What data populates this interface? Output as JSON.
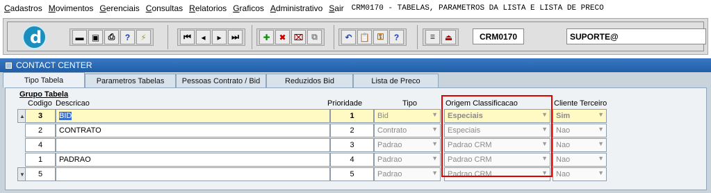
{
  "menu": {
    "items": [
      "Cadastros",
      "Movimentos",
      "Gerenciais",
      "Consultas",
      "Relatorios",
      "Graficos",
      "Administrativo",
      "Sair"
    ],
    "form_title": "CRM0170 - TABELAS, PARAMETROS DA LISTA E LISTA DE PRECO"
  },
  "toolbar": {
    "logo_letter": "d",
    "form_code": "CRM0170",
    "user": "SUPORTE@",
    "icons": [
      "save-icon",
      "frame-icon",
      "print-icon",
      "help-query-icon",
      "edit-wand-icon",
      "first-record-icon",
      "prev-record-icon",
      "next-record-icon",
      "last-record-icon",
      "add-record-icon",
      "delete-record-icon",
      "clear-icon",
      "duplicate-icon",
      "undo-icon",
      "clipboard-icon",
      "lock-keys-icon",
      "question-icon",
      "menu-icon",
      "exit-icon"
    ]
  },
  "window": {
    "title": "CONTACT CENTER"
  },
  "tabs": [
    "Tipo Tabela",
    "Parametros Tabelas",
    "Pessoas Contrato / Bid",
    "Reduzidos Bid",
    "Lista de Preco"
  ],
  "active_tab": "Tipo Tabela",
  "group": {
    "title": "Grupo Tabela",
    "headers": {
      "codigo": "Codigo",
      "descricao": "Descricao",
      "prioridade": "Prioridade",
      "tipo": "Tipo",
      "origem": "Origem Classificacao",
      "cliente": "Cliente Terceiro"
    }
  },
  "rows": [
    {
      "codigo": "3",
      "descricao": "BID",
      "prioridade": "1",
      "tipo": "Bid",
      "origem": "Especiais",
      "cliente": "Sim"
    },
    {
      "codigo": "2",
      "descricao": "CONTRATO",
      "prioridade": "2",
      "tipo": "Contrato",
      "origem": "Especiais",
      "cliente": "Nao"
    },
    {
      "codigo": "4",
      "descricao": "",
      "prioridade": "3",
      "tipo": "Padrao",
      "origem": "Padrao CRM",
      "cliente": "Nao"
    },
    {
      "codigo": "1",
      "descricao": "PADRAO",
      "prioridade": "4",
      "tipo": "Padrao",
      "origem": "Padrao CRM",
      "cliente": "Nao"
    },
    {
      "codigo": "5",
      "descricao": "",
      "prioridade": "5",
      "tipo": "Padrao",
      "origem": "Padrao CRM",
      "cliente": "Nao"
    }
  ],
  "colors": {
    "highlight": "#e00000",
    "current_row": "#fff9c4",
    "titlebar": "#1f5fa8"
  }
}
